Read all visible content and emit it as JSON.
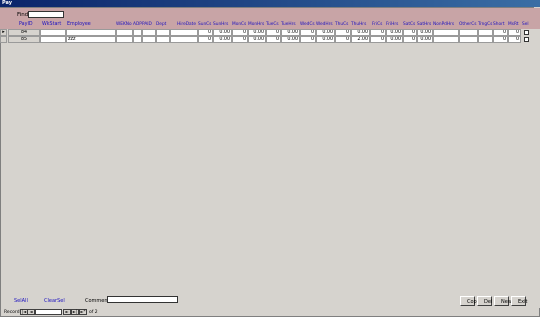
{
  "window": {
    "title": "Pay"
  },
  "find": {
    "label": "Find",
    "value": ""
  },
  "columns": [
    {
      "key": "payid",
      "label": "PayID"
    },
    {
      "key": "wkstart",
      "label": "WkStart"
    },
    {
      "key": "employee",
      "label": "Employee"
    },
    {
      "key": "wkno",
      "label": "WEKNo"
    },
    {
      "key": "adp",
      "label": "ADP"
    },
    {
      "key": "paid",
      "label": "PAID"
    },
    {
      "key": "dept",
      "label": "Dept"
    },
    {
      "key": "hiredate",
      "label": "HireDate"
    },
    {
      "key": "sunc",
      "label": "SunCs"
    },
    {
      "key": "sunh",
      "label": "SunHrs"
    },
    {
      "key": "monc",
      "label": "MonCs"
    },
    {
      "key": "monh",
      "label": "MonHrs"
    },
    {
      "key": "tuec",
      "label": "TueCs"
    },
    {
      "key": "tueh",
      "label": "TueHrs"
    },
    {
      "key": "wedc",
      "label": "WedCs"
    },
    {
      "key": "wedh",
      "label": "WedHrs"
    },
    {
      "key": "thuc",
      "label": "ThuCs"
    },
    {
      "key": "thuh",
      "label": "ThuHrs"
    },
    {
      "key": "fric",
      "label": "FriCs"
    },
    {
      "key": "frih",
      "label": "FriHrs"
    },
    {
      "key": "satc",
      "label": "SatCs"
    },
    {
      "key": "sath",
      "label": "SatHrs"
    },
    {
      "key": "nonpd",
      "label": "NonPdHrs"
    },
    {
      "key": "other",
      "label": "OtherCs"
    },
    {
      "key": "trng",
      "label": "TrngCs"
    },
    {
      "key": "shrt",
      "label": "Short"
    },
    {
      "key": "misc",
      "label": "MsRt"
    },
    {
      "key": "sel",
      "label": "Sel"
    }
  ],
  "rows": [
    {
      "current": true,
      "payid": "84",
      "wkstart": "",
      "employee": "",
      "wkno": "",
      "adp": "",
      "paid": "",
      "dept": "",
      "hiredate": "",
      "sunc": "0",
      "sunh": "0.00",
      "monc": "0",
      "monh": "0.00",
      "tuec": "0",
      "tueh": "0.00",
      "wedc": "0",
      "wedh": "0.00",
      "thuc": "0",
      "thuh": "0.00",
      "fric": "0",
      "frih": "0.00",
      "satc": "0",
      "sath": "0.00",
      "nonpd": "",
      "other": "",
      "trng": "",
      "shrt": "0",
      "misc": "0",
      "sel": false
    },
    {
      "current": false,
      "payid": "85",
      "wkstart": "",
      "employee": "zzz",
      "wkno": "",
      "adp": "",
      "paid": "",
      "dept": "",
      "hiredate": "",
      "sunc": "0",
      "sunh": "0.00",
      "monc": "0",
      "monh": "0.00",
      "tuec": "0",
      "tueh": "0.00",
      "wedc": "0",
      "wedh": "0.00",
      "thuc": "0",
      "thuh": "2.00",
      "fric": "0",
      "frih": "0.00",
      "satc": "0",
      "sath": "0.00",
      "nonpd": "",
      "other": "",
      "trng": "",
      "shrt": "0",
      "misc": "0",
      "sel": false
    }
  ],
  "footer": {
    "select_all": "SelAll",
    "clear_sel": "ClearSel",
    "comment_label": "Comment",
    "comment_value": "",
    "buttons": {
      "copy": "Copy",
      "del": "Del",
      "new": "New",
      "exit": "Exit"
    }
  },
  "navigation": {
    "label": "Record:",
    "first": "|◄",
    "prev": "◄",
    "current": "",
    "next": "►",
    "last": "►|",
    "new": "►*",
    "of_text": "of 2"
  },
  "colors": {
    "header_bg": "#c8a4a6",
    "header_text": "#1a0fbf",
    "window_bg": "#d6d3ce",
    "titlebar": "#0a246a"
  }
}
